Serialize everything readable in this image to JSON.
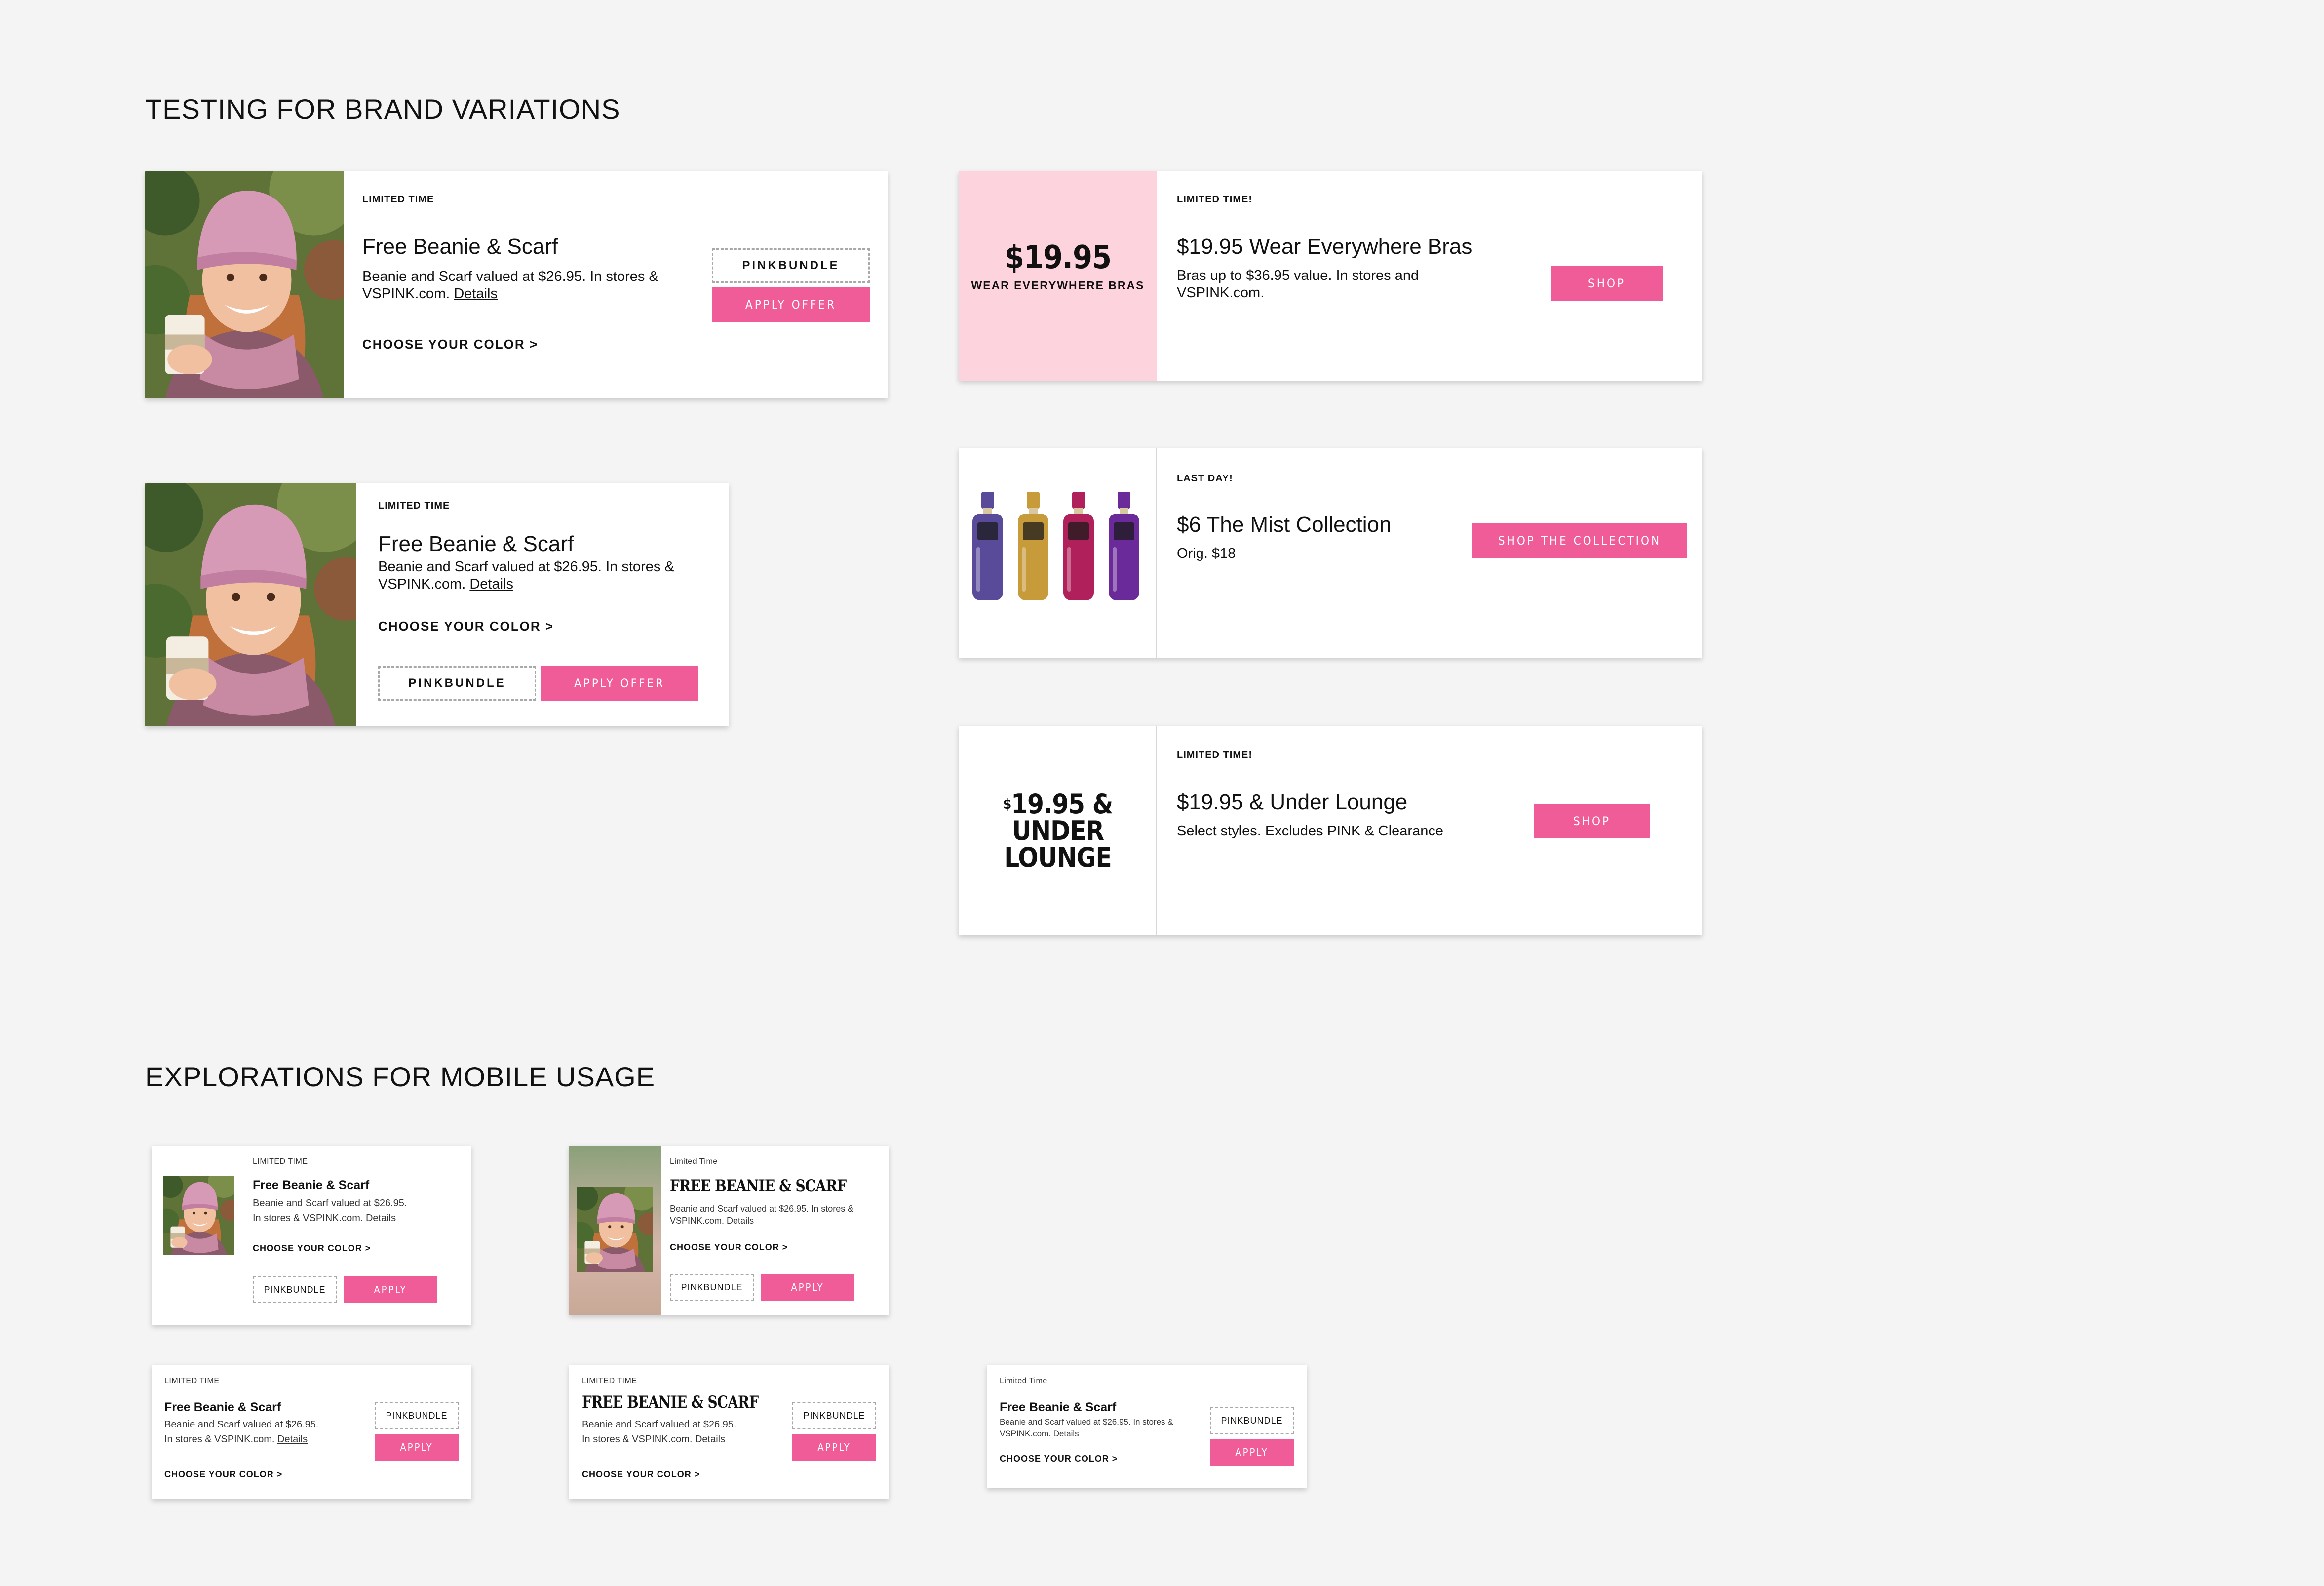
{
  "sections": {
    "brand": "TESTING FOR BRAND VARIATIONS",
    "mobile": "EXPLORATIONS FOR MOBILE USAGE"
  },
  "beanie": {
    "eyebrow": "LIMITED TIME",
    "title": "Free Beanie & Scarf",
    "body": "Beanie and Scarf valued at $26.95. In stores & VSPINK.com.",
    "details": "Details",
    "cta": "CHOOSE YOUR COLOR >",
    "code": "PINKBUNDLE",
    "apply": "APPLY OFFER"
  },
  "bras": {
    "price": "$19.95",
    "subtitle": "WEAR EVERYWHERE BRAS",
    "eyebrow": "LIMITED TIME!",
    "title": "$19.95 Wear Everywhere Bras",
    "body": "Bras up to $36.95 value. In stores and VSPINK.com.",
    "button": "SHOP"
  },
  "mist": {
    "eyebrow": "LAST DAY!",
    "title": "$6 The Mist Collection",
    "body": "Orig. $18",
    "button": "SHOP THE COLLECTION",
    "bottle_colors": [
      "#5a4a9a",
      "#c79a3a",
      "#b0205a",
      "#6a2a9a"
    ]
  },
  "lounge": {
    "price_sup": "$",
    "price_line1": "19.95 & UNDER",
    "price_line2": "LOUNGE",
    "eyebrow": "LIMITED TIME!",
    "title": "$19.95 & Under Lounge",
    "body": "Select styles. Excludes PINK & Clearance",
    "button": "SHOP"
  },
  "mobile": {
    "eyebrow_caps": "LIMITED TIME",
    "eyebrow_title": "Limited Time",
    "title": "Free Beanie & Scarf",
    "title_varsity": "FREE BEANIE & SCARF",
    "body": "Beanie and Scarf valued at $26.95.",
    "body2": "In stores & VSPINK.com.",
    "details": "Details",
    "cta": "CHOOSE YOUR COLOR >",
    "code": "PINKBUNDLE",
    "apply": "APPLY"
  },
  "colors": {
    "accent": "#ef5c98",
    "accent_light": "#fdd3dd",
    "background": "#f4f4f4"
  }
}
